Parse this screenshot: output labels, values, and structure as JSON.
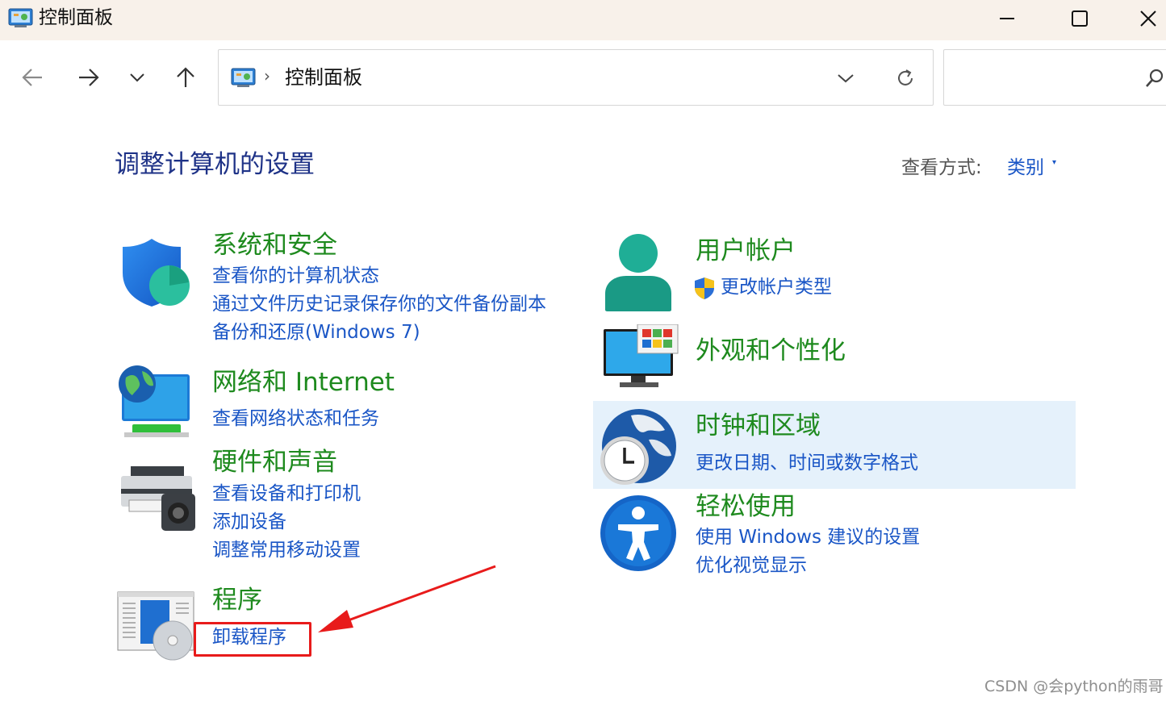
{
  "window": {
    "title": "控制面板"
  },
  "address_bar": {
    "path": "控制面板",
    "separator": "›"
  },
  "search": {
    "placeholder": ""
  },
  "header": {
    "title": "调整计算机的设置",
    "view_by_label": "查看方式:",
    "view_by_value": "类别",
    "view_by_caret": "▾"
  },
  "left_categories": [
    {
      "title": "系统和安全",
      "links": [
        "查看你的计算机状态",
        "通过文件历史记录保存你的文件备份副本",
        "备份和还原(Windows 7)"
      ]
    },
    {
      "title": "网络和 Internet",
      "links": [
        "查看网络状态和任务"
      ]
    },
    {
      "title": "硬件和声音",
      "links": [
        "查看设备和打印机",
        "添加设备",
        "调整常用移动设置"
      ]
    },
    {
      "title": "程序",
      "links": [
        "卸载程序"
      ]
    }
  ],
  "right_categories": [
    {
      "title": "用户帐户",
      "links": [
        "更改帐户类型"
      ]
    },
    {
      "title": "外观和个性化",
      "links": []
    },
    {
      "title": "时钟和区域",
      "links": [
        "更改日期、时间或数字格式"
      ]
    },
    {
      "title": "轻松使用",
      "links": [
        "使用 Windows 建议的设置",
        "优化视觉显示"
      ]
    }
  ],
  "watermark": "CSDN @会python的雨哥",
  "colors": {
    "title_green": "#1e8a1e",
    "link_blue": "#1a56c6",
    "heading_blue": "#1e3287",
    "highlight": "#e5f1fb",
    "annotation_red": "#e81b1b"
  }
}
